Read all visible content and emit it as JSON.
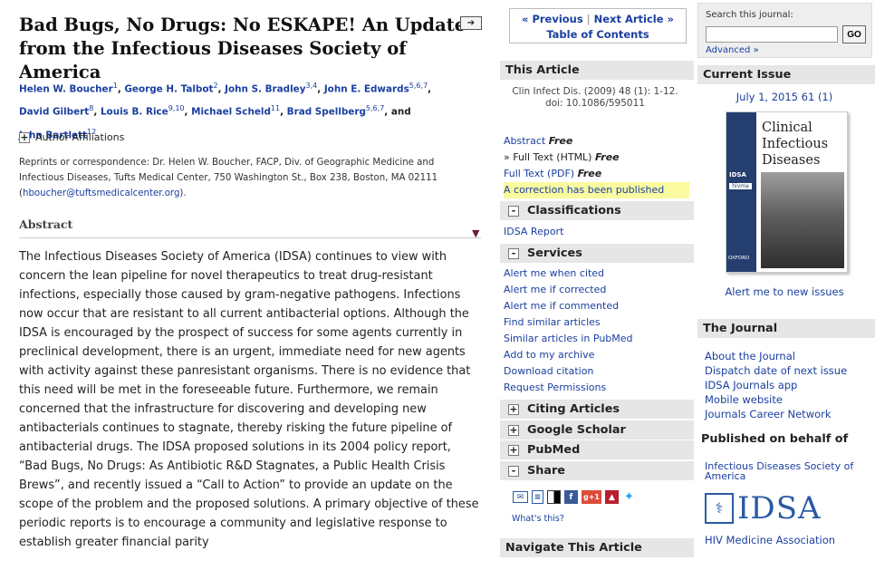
{
  "article": {
    "title": "Bad Bugs, No Drugs: No ESKAPE! An Update from the Infectious Diseases Society of America",
    "expand_icon": "arrow-right-box-icon",
    "authors": [
      {
        "name": "Helen W. Boucher",
        "sup": "1"
      },
      {
        "name": "George H. Talbot",
        "sup": "2"
      },
      {
        "name": "John S. Bradley",
        "sup": "3,4"
      },
      {
        "name": "John E. Edwards",
        "sup": "5,6,7"
      },
      {
        "name": "David Gilbert",
        "sup": "8"
      },
      {
        "name": "Louis B. Rice",
        "sup": "9,10"
      },
      {
        "name": "Michael Scheld",
        "sup": "11"
      },
      {
        "name": "Brad Spellberg",
        "sup": "5,6,7"
      },
      {
        "name": "John Bartlett",
        "sup": "12"
      }
    ],
    "and_text": "and",
    "affiliations_label": "Author Affiliations",
    "correspondence": "Reprints or correspondence: Dr. Helen W. Boucher, FACP, Div. of Geographic Medicine and Infectious Diseases, Tufts Medical Center, 750 Washington St., Box 238, Boston, MA 02111",
    "correspondence_email": "hboucher@tuftsmedicalcenter.org",
    "abstract_heading": "Abstract",
    "abstract_text": "The Infectious Diseases Society of America (IDSA) continues to view with concern the lean pipeline for novel therapeutics to treat drug-resistant infections, especially those caused by gram-negative pathogens. Infections now occur that are resistant to all current antibacterial options. Although the IDSA is encouraged by the prospect of success for some agents currently in preclinical development, there is an urgent, immediate need for new agents with activity against these panresistant organisms. There is no evidence that this need will be met in the foreseeable future. Furthermore, we remain concerned that the infrastructure for discovering and developing new antibacterials continues to stagnate, thereby risking the future pipeline of antibacterial drugs. The IDSA proposed solutions in its 2004 policy report, “Bad Bugs, No Drugs: As Antibiotic R&D Stagnates, a Public Health Crisis Brews”, and recently issued a “Call to Action” to provide an update on the scope of the problem and the proposed solutions. A primary objective of these periodic reports is to encourage a community and legislative response to establish greater financial parity"
  },
  "nav": {
    "previous": "« Previous",
    "next": "Next Article »",
    "sep": "|",
    "toc": "Table of Contents"
  },
  "this_article": {
    "heading": "This Article",
    "citation": "Clin Infect Dis. (2009) 48 (1): 1-12.",
    "doi": "doi: 10.1086/595011",
    "links": [
      {
        "label": "Abstract",
        "free": "Free",
        "prefix": ""
      },
      {
        "label": "Full Text (HTML)",
        "free": "Free",
        "prefix": "» "
      },
      {
        "label": "Full Text (PDF)",
        "free": "Free",
        "prefix": ""
      }
    ],
    "correction": "A correction has been published"
  },
  "classifications": {
    "heading": "Classifications",
    "links": [
      "IDSA Report"
    ]
  },
  "services": {
    "heading": "Services",
    "links": [
      "Alert me when cited",
      "Alert me if corrected",
      "Alert me if commented",
      "Find similar articles",
      "Similar articles in PubMed",
      "Add to my archive",
      "Download citation",
      "Request Permissions"
    ]
  },
  "collapsed_sections": [
    {
      "label": "Citing Articles"
    },
    {
      "label": "Google Scholar"
    },
    {
      "label": "PubMed"
    }
  ],
  "share": {
    "heading": "Share",
    "icons": [
      "email-icon",
      "citeulike-icon",
      "delicious-icon",
      "facebook-icon",
      "google-plus-icon",
      "mendeley-icon",
      "twitter-icon"
    ],
    "google_plus_text": "g+1",
    "whats_this": "What's this?"
  },
  "navigate": {
    "heading": "Navigate This Article"
  },
  "search": {
    "label": "Search this journal:",
    "value": "",
    "go": "GO",
    "advanced": "Advanced »"
  },
  "current_issue": {
    "heading": "Current Issue",
    "date": "July 1, 2015 61 (1)",
    "cover_title": "Clinical Infectious Diseases",
    "cover_idsa": "IDSA",
    "cover_hivma": "hivma",
    "cover_oxford": "OXFORD",
    "alert": "Alert me to new issues"
  },
  "journal": {
    "heading": "The Journal",
    "links": [
      "About the Journal",
      "Dispatch date of next issue",
      "IDSA Journals app",
      "Mobile website",
      "Journals Career Network"
    ]
  },
  "published": {
    "heading": "Published on behalf of",
    "society": "Infectious Diseases Society of America",
    "logo_text": "IDSA",
    "hiv": "HIV Medicine Association"
  },
  "colors": {
    "link": "#1a3fa0",
    "section_bg": "#e6e6e6",
    "highlight": "#fafaa0",
    "abstract_arrow": "#6a1b3a"
  }
}
